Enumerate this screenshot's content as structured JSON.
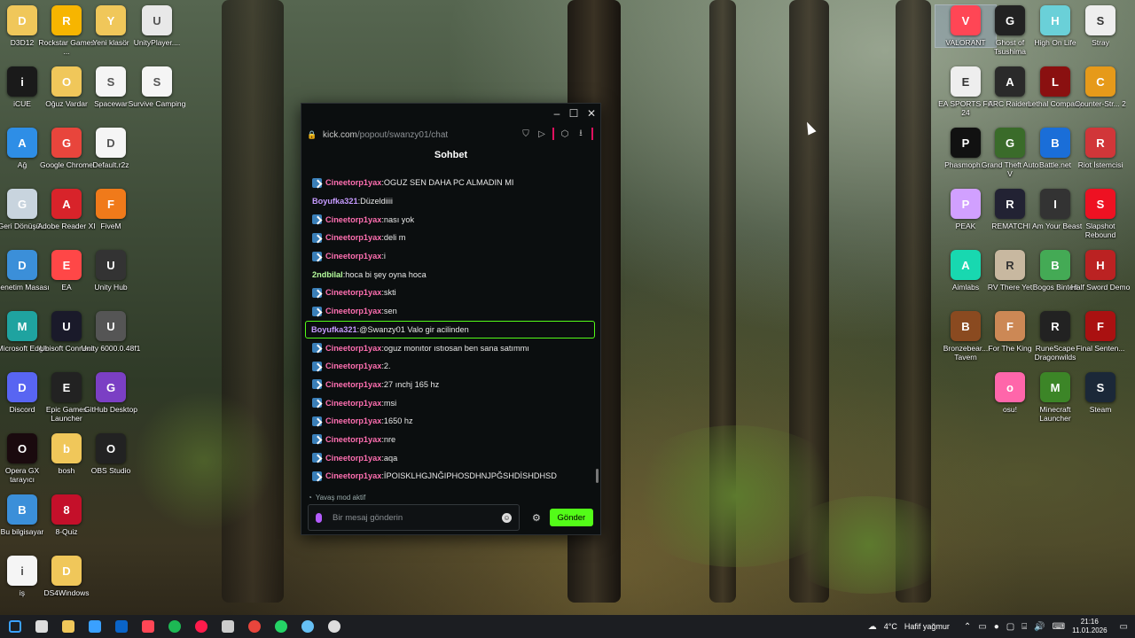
{
  "desktop_left": [
    {
      "label": "D3D12",
      "icon": "folder-icon",
      "color": "#f0c75a"
    },
    {
      "label": "Rockstar Games ...",
      "icon": "rockstar-icon",
      "color": "#f7b500"
    },
    {
      "label": "Yeni klasör",
      "icon": "folder-icon",
      "color": "#f0c75a"
    },
    {
      "label": "UnityPlayer....",
      "icon": "file-icon",
      "color": "#e8e8e8"
    },
    {
      "label": "iCUE",
      "icon": "icue-icon",
      "color": "#1a1a1a"
    },
    {
      "label": "Oğuz Vardar",
      "icon": "user-folder-icon",
      "color": "#f0c75a"
    },
    {
      "label": "Spacewar",
      "icon": "file-icon",
      "color": "#f5f5f5"
    },
    {
      "label": "Survive Camping",
      "icon": "file-icon",
      "color": "#f5f5f5"
    },
    {
      "label": "Ağ",
      "icon": "network-icon",
      "color": "#2e8ee6"
    },
    {
      "label": "Google Chrome",
      "icon": "chrome-icon",
      "color": "#e8453c"
    },
    {
      "label": "Default.r2z",
      "icon": "file-icon",
      "color": "#f5f5f5"
    },
    {
      "label": "Geri Dönüşü...",
      "icon": "recycle-bin-icon",
      "color": "#c8d4de"
    },
    {
      "label": "Adobe Reader XI",
      "icon": "adobe-reader-icon",
      "color": "#d8232a"
    },
    {
      "label": "FiveM",
      "icon": "fivem-icon",
      "color": "#f07a1a"
    },
    {
      "label": "Denetim Masası",
      "icon": "control-panel-icon",
      "color": "#3b8fd9"
    },
    {
      "label": "EA",
      "icon": "ea-icon",
      "color": "#ff4747"
    },
    {
      "label": "Unity Hub",
      "icon": "unity-icon",
      "color": "#333"
    },
    {
      "label": "Microsoft Edge",
      "icon": "edge-icon",
      "color": "#1fa3a0"
    },
    {
      "label": "Ubisoft Connect",
      "icon": "ubisoft-icon",
      "color": "#1a1a2a"
    },
    {
      "label": "Unity 6000.0.48f1",
      "icon": "unity-icon",
      "color": "#555"
    },
    {
      "label": "Discord",
      "icon": "discord-icon",
      "color": "#5865f2"
    },
    {
      "label": "Epic Games Launcher",
      "icon": "epic-icon",
      "color": "#222"
    },
    {
      "label": "GitHub Desktop",
      "icon": "github-icon",
      "color": "#7b3fc4"
    },
    {
      "label": "Opera GX tarayıcı",
      "icon": "opera-gx-icon",
      "color": "#1a0a0e"
    },
    {
      "label": "bosh",
      "icon": "folder-icon",
      "color": "#f0c75a"
    },
    {
      "label": "OBS Studio",
      "icon": "obs-icon",
      "color": "#222"
    },
    {
      "label": "Bu bilgisayar",
      "icon": "computer-icon",
      "color": "#3b8fd9"
    },
    {
      "label": "8-Quiz",
      "icon": "opera-icon",
      "color": "#c4102a"
    },
    {
      "label": "iş",
      "icon": "file-icon",
      "color": "#f5f5f5"
    },
    {
      "label": "DS4Windows",
      "icon": "folder-icon",
      "color": "#f0c75a"
    }
  ],
  "desktop_right": [
    {
      "label": "VALORANT",
      "icon": "valorant-icon",
      "color": "#ff4655"
    },
    {
      "label": "Ghost of Tsushima",
      "icon": "ghost-icon",
      "color": "#222"
    },
    {
      "label": "High On Life",
      "icon": "high-on-life-icon",
      "color": "#6ad0d8"
    },
    {
      "label": "Stray",
      "icon": "stray-icon",
      "color": "#eee"
    },
    {
      "label": "EA SPORTS FC 24",
      "icon": "fc24-icon",
      "color": "#eee"
    },
    {
      "label": "ARC Raiders",
      "icon": "arc-raiders-icon",
      "color": "#2a2a2a"
    },
    {
      "label": "Lethal Company",
      "icon": "lethal-company-icon",
      "color": "#8a1010"
    },
    {
      "label": "Counter-Str... 2",
      "icon": "cs2-icon",
      "color": "#e69a1a"
    },
    {
      "label": "Phasmoph...",
      "icon": "phasmophobia-icon",
      "color": "#111"
    },
    {
      "label": "Grand Theft Auto V",
      "icon": "gta-icon",
      "color": "#3a6b2a"
    },
    {
      "label": "Battle.net",
      "icon": "battlenet-icon",
      "color": "#1a6ed8"
    },
    {
      "label": "Riot İstemcisi",
      "icon": "riot-icon",
      "color": "#d13639"
    },
    {
      "label": "PEAK",
      "icon": "peak-icon",
      "color": "#d1a0ff"
    },
    {
      "label": "REMATCH",
      "icon": "rematch-icon",
      "color": "#223"
    },
    {
      "label": "I Am Your Beast",
      "icon": "beast-icon",
      "color": "#333"
    },
    {
      "label": "Slapshot Rebound",
      "icon": "slapshot-icon",
      "color": "#e12"
    },
    {
      "label": "Aimlabs",
      "icon": "aimlabs-icon",
      "color": "#18d8b0"
    },
    {
      "label": "RV There Yet",
      "icon": "rv-icon",
      "color": "#c8b8a0"
    },
    {
      "label": "Bogos Binted",
      "icon": "alien-icon",
      "color": "#4a5"
    },
    {
      "label": "Half Sword Demo",
      "icon": "half-sword-icon",
      "color": "#b22"
    },
    {
      "label": "Bronzebear... Tavern",
      "icon": "tavern-icon",
      "color": "#8a4a20"
    },
    {
      "label": "For The King",
      "icon": "for-the-king-icon",
      "color": "#c85"
    },
    {
      "label": "RuneScape Dragonwilds",
      "icon": "runescape-icon",
      "color": "#222"
    },
    {
      "label": "Final Senten...",
      "icon": "final-sentence-icon",
      "color": "#a11"
    },
    {
      "label": "osu!",
      "icon": "osu-icon",
      "color": "#ff66aa"
    },
    {
      "label": "Minecraft Launcher",
      "icon": "minecraft-icon",
      "color": "#3c8527"
    },
    {
      "label": "Steam",
      "icon": "steam-icon",
      "color": "#1b2838"
    }
  ],
  "window": {
    "url_host": "kick.com",
    "url_path": "/popout/swanzy01/chat",
    "chat_title": "Sohbet",
    "messages": [
      {
        "user": "Cineetorp1yax",
        "text": "OGUZ SEN DAHA PC ALMADIN MI",
        "color": "pink",
        "badge": true
      },
      {
        "user": "Boyufka321",
        "text": "Düzeldiiii",
        "color": "purple",
        "badge": false
      },
      {
        "user": "Cineetorp1yax",
        "text": "nası yok",
        "color": "pink",
        "badge": true
      },
      {
        "user": "Cineetorp1yax",
        "text": "deli m",
        "color": "pink",
        "badge": true
      },
      {
        "user": "Cineetorp1yax",
        "text": "i",
        "color": "pink",
        "badge": true
      },
      {
        "user": "2ndbilal",
        "text": "hoca bi şey oyna hoca",
        "color": "green",
        "badge": false
      },
      {
        "user": "Cineetorp1yax",
        "text": "skti",
        "color": "pink",
        "badge": true
      },
      {
        "user": "Cineetorp1yax",
        "text": "sen",
        "color": "pink",
        "badge": true
      },
      {
        "user": "Boyufka321",
        "text": "@Swanzy01 Valo gir acilinden",
        "color": "purple",
        "badge": false,
        "highlight": true
      },
      {
        "user": "Cineetorp1yax",
        "text": "oguz monıtor ıstıosan ben sana satımmı",
        "color": "pink",
        "badge": true
      },
      {
        "user": "Cineetorp1yax",
        "text": "2.",
        "color": "pink",
        "badge": true
      },
      {
        "user": "Cineetorp1yax",
        "text": "27 ınchj 165 hz",
        "color": "pink",
        "badge": true
      },
      {
        "user": "Cineetorp1yax",
        "text": "msi",
        "color": "pink",
        "badge": true
      },
      {
        "user": "Cineetorp1yax",
        "text": "1650 hz",
        "color": "pink",
        "badge": true
      },
      {
        "user": "Cineetorp1yax",
        "text": "nre",
        "color": "pink",
        "badge": true
      },
      {
        "user": "Cineetorp1yax",
        "text": "aqa",
        "color": "pink",
        "badge": true
      },
      {
        "user": "Cineetorp1yax",
        "text": "İPOISKLHGJNĞIPHOSDHNJPĞSHDİSHDHSD",
        "color": "pink",
        "badge": true
      }
    ],
    "slow_mode": "Yavaş mod aktif",
    "input_placeholder": "Bir mesaj gönderin",
    "send_label": "Gönder"
  },
  "taskbar": {
    "weather_temp": "4°C",
    "weather_text": "Hafif yağmur",
    "time": "21:16",
    "date": "11.01.2026",
    "apps": [
      {
        "icon": "start-icon",
        "color": "#3aa0ff"
      },
      {
        "icon": "task-view-icon",
        "color": "#ddd"
      },
      {
        "icon": "file-explorer-icon",
        "color": "#f0c75a"
      },
      {
        "icon": "store-icon",
        "color": "#3aa0ff"
      },
      {
        "icon": "outlook-icon",
        "color": "#0a64c8"
      },
      {
        "icon": "valorant-icon",
        "color": "#ff4655"
      },
      {
        "icon": "spotify-icon",
        "color": "#1db954"
      },
      {
        "icon": "opera-gx-icon",
        "color": "#ff1b4b"
      },
      {
        "icon": "unity-hub-icon",
        "color": "#ccc"
      },
      {
        "icon": "chrome-icon",
        "color": "#e8453c"
      },
      {
        "icon": "whatsapp-icon",
        "color": "#25d366"
      },
      {
        "icon": "steam-icon",
        "color": "#66c0f4"
      },
      {
        "icon": "github-icon",
        "color": "#ddd"
      }
    ]
  }
}
